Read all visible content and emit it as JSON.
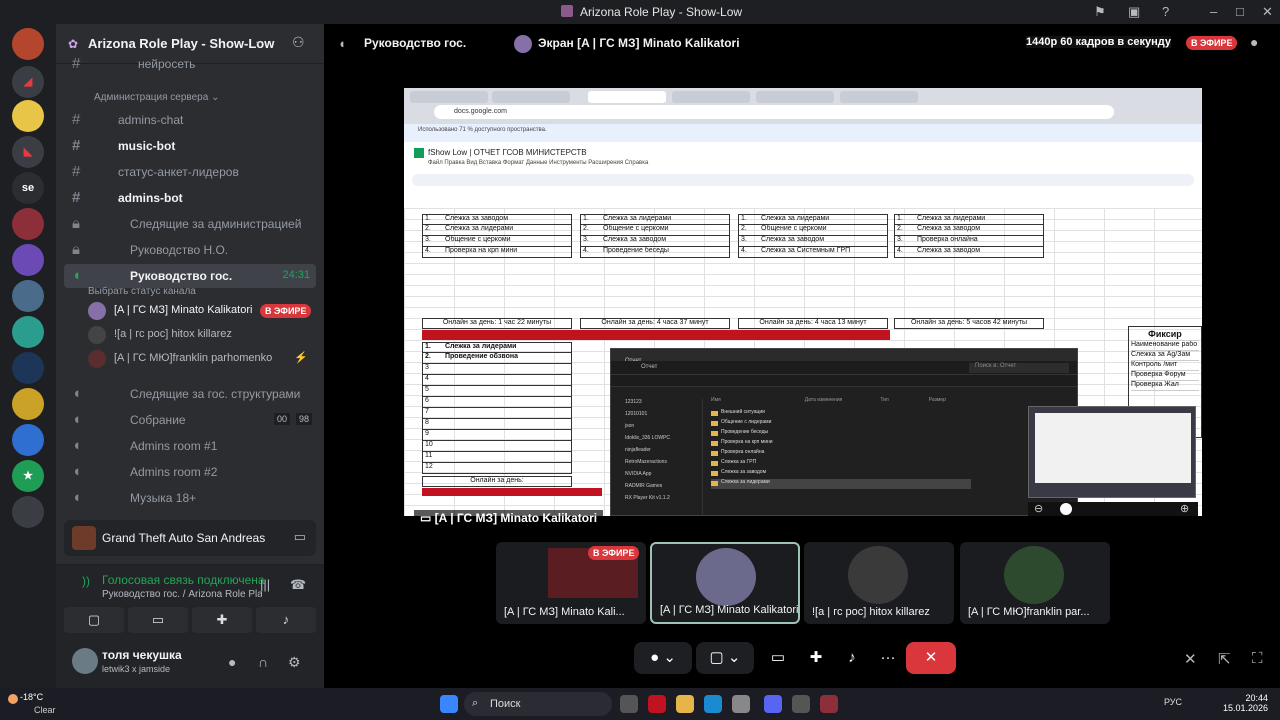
{
  "window": {
    "title": "Arizona Role Play - Show-Low"
  },
  "server": {
    "name": "Arizona Role Play - Show-Low"
  },
  "channels": {
    "items": [
      {
        "label": "нейросеть",
        "icon": "#"
      },
      {
        "label": "admins-chat",
        "icon": "#"
      },
      {
        "label": "music-bot",
        "icon": "#"
      },
      {
        "label": "статус-анкет-лидеров",
        "icon": "#"
      },
      {
        "label": "admins-bot",
        "icon": "#"
      },
      {
        "label": "Следящие за администрацией",
        "icon": "lock"
      },
      {
        "label": "Руководство Н.О.",
        "icon": "lock"
      },
      {
        "label": "Руководство гос.",
        "icon": "speaker",
        "time": "24:31"
      },
      {
        "label": "Следящие за гос. структурами",
        "icon": "speaker"
      },
      {
        "label": "Собрание",
        "icon": "speaker"
      },
      {
        "label": "Admins room #1",
        "icon": "speaker"
      },
      {
        "label": "Admins room #2",
        "icon": "speaker"
      },
      {
        "label": "Музыка 18+",
        "icon": "speaker"
      }
    ],
    "category": "Администрация сервера",
    "status_hint": "Выбрать статус канала",
    "meeting_counts": [
      "00",
      "98"
    ],
    "voice_users": [
      "[A | ГС МЗ] Minato Kalikatori",
      "![a | гс рос] hitox killarez",
      "[A | ГС МЮ]franklin parhomenko"
    ]
  },
  "live_label": "В ЭФИРЕ",
  "game": {
    "name": "Grand Theft Auto San Andreas"
  },
  "voice": {
    "status": "Голосовая связь подключена",
    "subtitle": "Руководство гос. / Arizona Role Play - S..."
  },
  "user": {
    "name": "толя чекушка",
    "status": "letwik3 x jamside"
  },
  "stage": {
    "channel": "Руководство гос.",
    "screen_label": "Экран [A | ГС МЗ] Minato Kalikatori",
    "quality": "1440p 60 кадров в секунду",
    "stream_label": "[A | ГС МЗ] Minato Kalikatori"
  },
  "sheet": {
    "url": "docs.google.com",
    "notice": "Использовано 71 % доступного пространства.",
    "title": "fShow Low | ОТЧЕТ ГСОВ МИНИСТЕРСТВ",
    "menu": "Файл  Правка  Вид  Вставка  Формат  Данные  Инструменты  Расширения  Справка",
    "columns": [
      [
        "Слежка за заводом",
        "Слежка за лидерами",
        "Общение с церкоми",
        "Проверка на крп мини"
      ],
      [
        "Слежка за лидерами",
        "Общение с церкоми",
        "Слежка за заводом",
        "Проведение беседы"
      ],
      [
        "Слежка за лидерами",
        "Общение с церкоми",
        "Слежка за заводом",
        "Слежка за Системным ГРП"
      ],
      [
        "Слежка за лидерами",
        "Слежка за заводом",
        "Проверка онлайна",
        "Слежка за заводом"
      ]
    ],
    "online": [
      "Онлайн за день: 1 час 22 минуты",
      "Онлайн за день: 4 часа 37 минут",
      "Онлайн за день: 4 часа 13 минут",
      "Онлайн за день: 5 часов 42 минуты"
    ],
    "lower": [
      "Слежка за лидерами",
      "Проведение обзвона"
    ],
    "online_bottom": "Онлайн за день:",
    "fix_title": "Фиксир",
    "fix_rows": [
      "Наименование рабо",
      "Слежка за Ag/Зам",
      "Контроль /мит",
      "Проверка Форум",
      "Проверка Жал"
    ]
  },
  "explorer": {
    "folder": "Отчет",
    "search": "Поиск в: Отчет",
    "headers": [
      "Имя",
      "Дата изменения",
      "Тип",
      "Размер"
    ],
    "side": [
      "123123",
      "12010101",
      "json",
      "Idoklix_336 LOWPC",
      "ninjafleader",
      "RetroMazeractions",
      "NVIDIA App",
      "RADMIR Games",
      "RX Player Kit v1.1.2"
    ],
    "files": [
      "Внешний ситуации",
      "Общение с лидерами",
      "Проведение беседы",
      "Проверка на крп мини",
      "Проверка онлайна",
      "Слежка за ГРП",
      "Слежка за заводом",
      "Слежка за лидерами"
    ]
  },
  "thumbs": [
    {
      "label": "[A | ГС МЗ] Minato Kali..."
    },
    {
      "label": "[A | ГС МЗ] Minato Kalikatori"
    },
    {
      "label": "![a | гс рос] hitox killarez"
    },
    {
      "label": "[A | ГС МЮ]franklin par..."
    }
  ],
  "taskbar": {
    "temp": "-18°C",
    "weather": "Clear",
    "search": "Поиск",
    "lang": "РУС",
    "time": "20:44",
    "date": "15.01.2026"
  },
  "colors": {
    "accent_green": "#23a55a",
    "live_red": "#da373c",
    "bg_dark": "#1e1f22"
  }
}
